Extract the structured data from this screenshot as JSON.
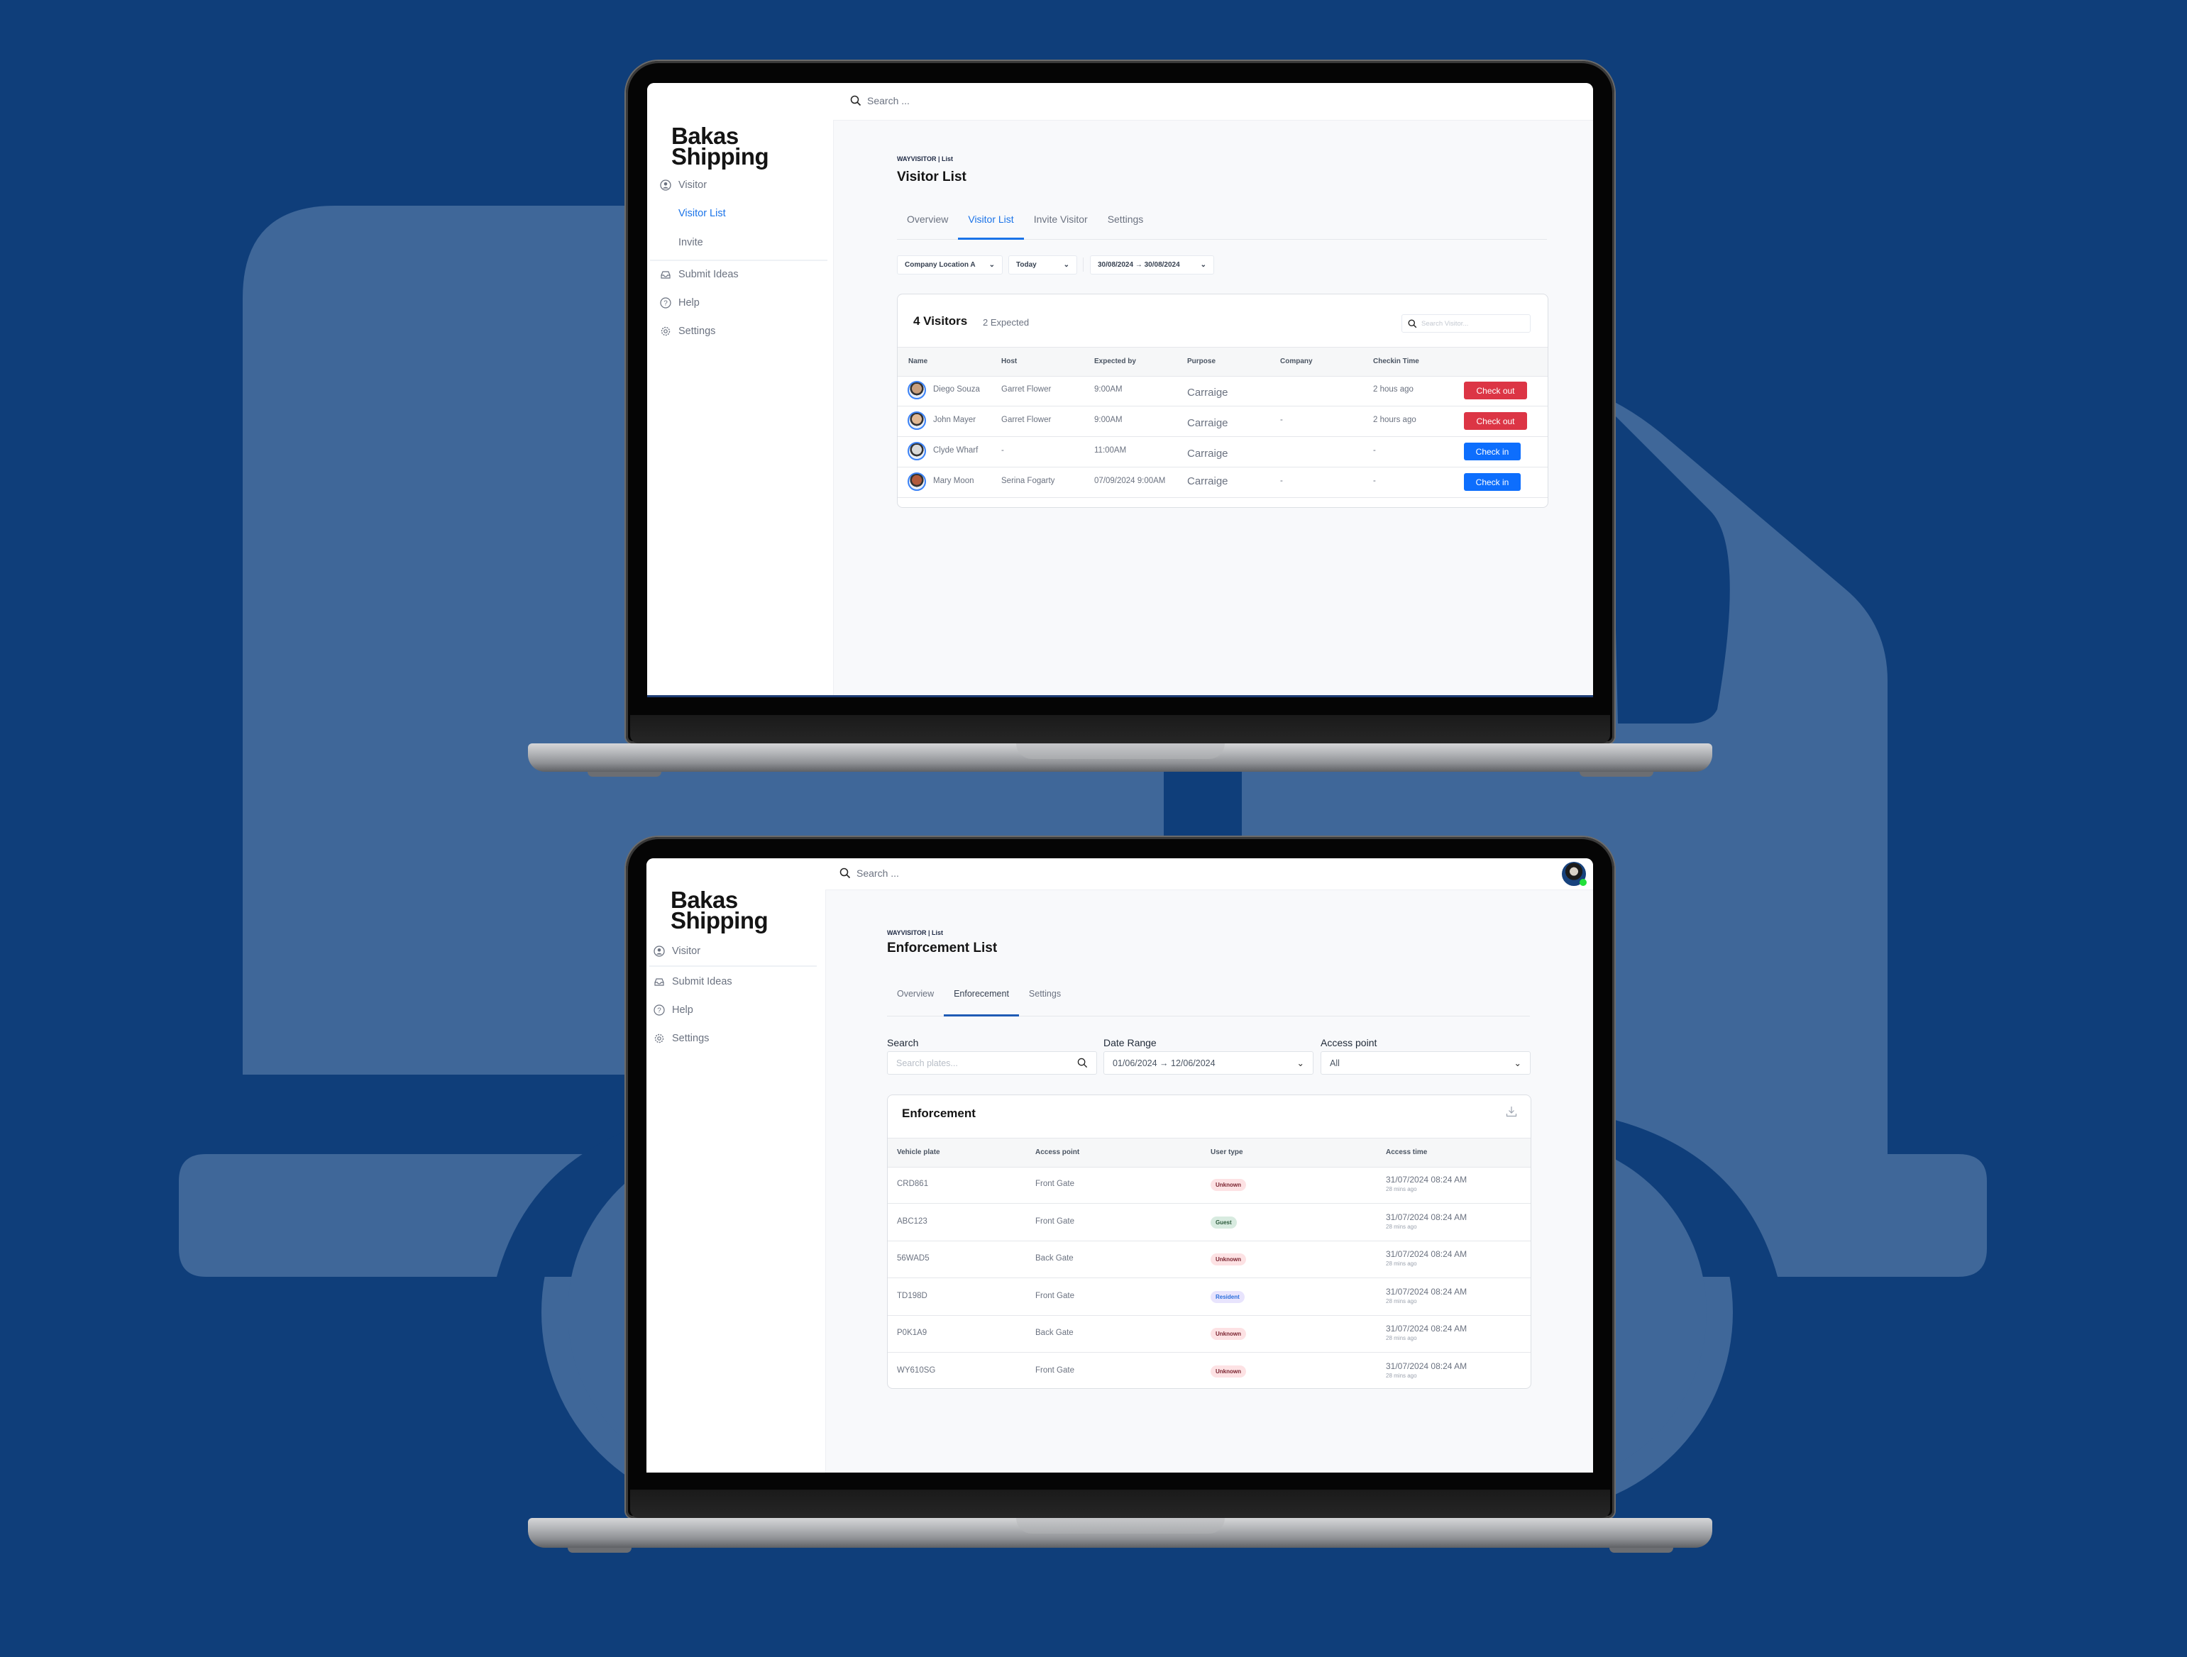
{
  "colors": {
    "background": "#0f3e7a",
    "background_shape": "#3f6799",
    "accent_blue": "#1a73e8",
    "check_out_red": "#dc3545",
    "check_in_blue": "#0d6efd",
    "badge_unknown_bg": "#fde2e4",
    "badge_unknown_text": "#7a2430",
    "badge_guest_bg": "#d8ebe0",
    "badge_guest_text": "#2c5a3b",
    "badge_resident_bg": "#e8e4fd",
    "badge_resident_text": "#2a6fdb"
  },
  "visitor_screen": {
    "brand": {
      "line1": "Bakas",
      "line2": "Shipping"
    },
    "sidebar": {
      "items": [
        {
          "label": "Visitor",
          "icon": "user-circle-icon"
        },
        {
          "label": "Visitor List",
          "active": true
        },
        {
          "label": "Invite"
        },
        {
          "label": "Submit Ideas",
          "icon": "inbox-icon"
        },
        {
          "label": "Help",
          "icon": "help-circle-icon"
        },
        {
          "label": "Settings",
          "icon": "gear-icon"
        }
      ]
    },
    "topbar": {
      "search_placeholder": "Search ..."
    },
    "breadcrumb": "WAYVISITOR | List",
    "title": "Visitor List",
    "tabs": [
      "Overview",
      "Visitor List",
      "Invite Visitor",
      "Settings"
    ],
    "active_tab": "Visitor List",
    "filters": {
      "location": "Company Location A",
      "period": "Today",
      "date_range": "30/08/2024 → 30/08/2024"
    },
    "card": {
      "count_label": "4 Visitors",
      "expected_label": "2 Expected",
      "search_placeholder": "Search Visitor..."
    },
    "table": {
      "columns": [
        "Name",
        "Host",
        "Expected by",
        "Purpose",
        "Company",
        "Checkin Time"
      ],
      "rows": [
        {
          "name": "Diego Souza",
          "host": "Garret Flower",
          "expected_by": "9:00AM",
          "purpose": "Carraige",
          "company": "",
          "checkin_time": "2 hous ago",
          "action": "Check out"
        },
        {
          "name": "John Mayer",
          "host": "Garret Flower",
          "expected_by": "9:00AM",
          "purpose": "Carraige",
          "company": "-",
          "checkin_time": "2 hours ago",
          "action": "Check out"
        },
        {
          "name": "Clyde Wharf",
          "host": "-",
          "expected_by": "11:00AM",
          "purpose": "Carraige",
          "company": "",
          "checkin_time": "-",
          "action": "Check in"
        },
        {
          "name": "Mary Moon",
          "host": "Serina Fogarty",
          "expected_by": "07/09/2024 9:00AM",
          "purpose": "Carraige",
          "company": "-",
          "checkin_time": "-",
          "action": "Check in"
        }
      ]
    }
  },
  "enforcement_screen": {
    "brand": {
      "line1": "Bakas",
      "line2": "Shipping"
    },
    "sidebar": {
      "items": [
        {
          "label": "Visitor",
          "icon": "user-circle-icon"
        },
        {
          "label": "Submit Ideas",
          "icon": "inbox-icon"
        },
        {
          "label": "Help",
          "icon": "help-circle-icon"
        },
        {
          "label": "Settings",
          "icon": "gear-icon"
        }
      ]
    },
    "topbar": {
      "search_placeholder": "Search ...",
      "user_status": "online"
    },
    "breadcrumb": "WAYVISITOR | List",
    "title": "Enforcement List",
    "tabs": [
      "Overview",
      "Enforecement",
      "Settings"
    ],
    "active_tab": "Enforecement",
    "filters": {
      "search_label": "Search",
      "search_placeholder": "Search plates...",
      "date_range_label": "Date Range",
      "date_range_value": "01/06/2024 → 12/06/2024",
      "access_point_label": "Access point",
      "access_point_value": "All"
    },
    "card": {
      "title": "Enforcement"
    },
    "table": {
      "columns": [
        "Vehicle plate",
        "Access point",
        "User type",
        "Access time"
      ],
      "rows": [
        {
          "plate": "CRD861",
          "access_point": "Front Gate",
          "user_type": "Unknown",
          "access_time": "31/07/2024 08:24 AM",
          "relative": "28 mins ago"
        },
        {
          "plate": "ABC123",
          "access_point": "Front Gate",
          "user_type": "Guest",
          "access_time": "31/07/2024 08:24 AM",
          "relative": "28 mins ago"
        },
        {
          "plate": "56WAD5",
          "access_point": "Back Gate",
          "user_type": "Unknown",
          "access_time": "31/07/2024 08:24 AM",
          "relative": "28 mins ago"
        },
        {
          "plate": "TD198D",
          "access_point": "Front Gate",
          "user_type": "Resident",
          "access_time": "31/07/2024 08:24 AM",
          "relative": "28 mins ago"
        },
        {
          "plate": "P0K1A9",
          "access_point": "Back Gate",
          "user_type": "Unknown",
          "access_time": "31/07/2024 08:24 AM",
          "relative": "28 mins ago"
        },
        {
          "plate": "WY610SG",
          "access_point": "Front Gate",
          "user_type": "Unknown",
          "access_time": "31/07/2024 08:24 AM",
          "relative": "28 mins ago"
        }
      ]
    }
  }
}
